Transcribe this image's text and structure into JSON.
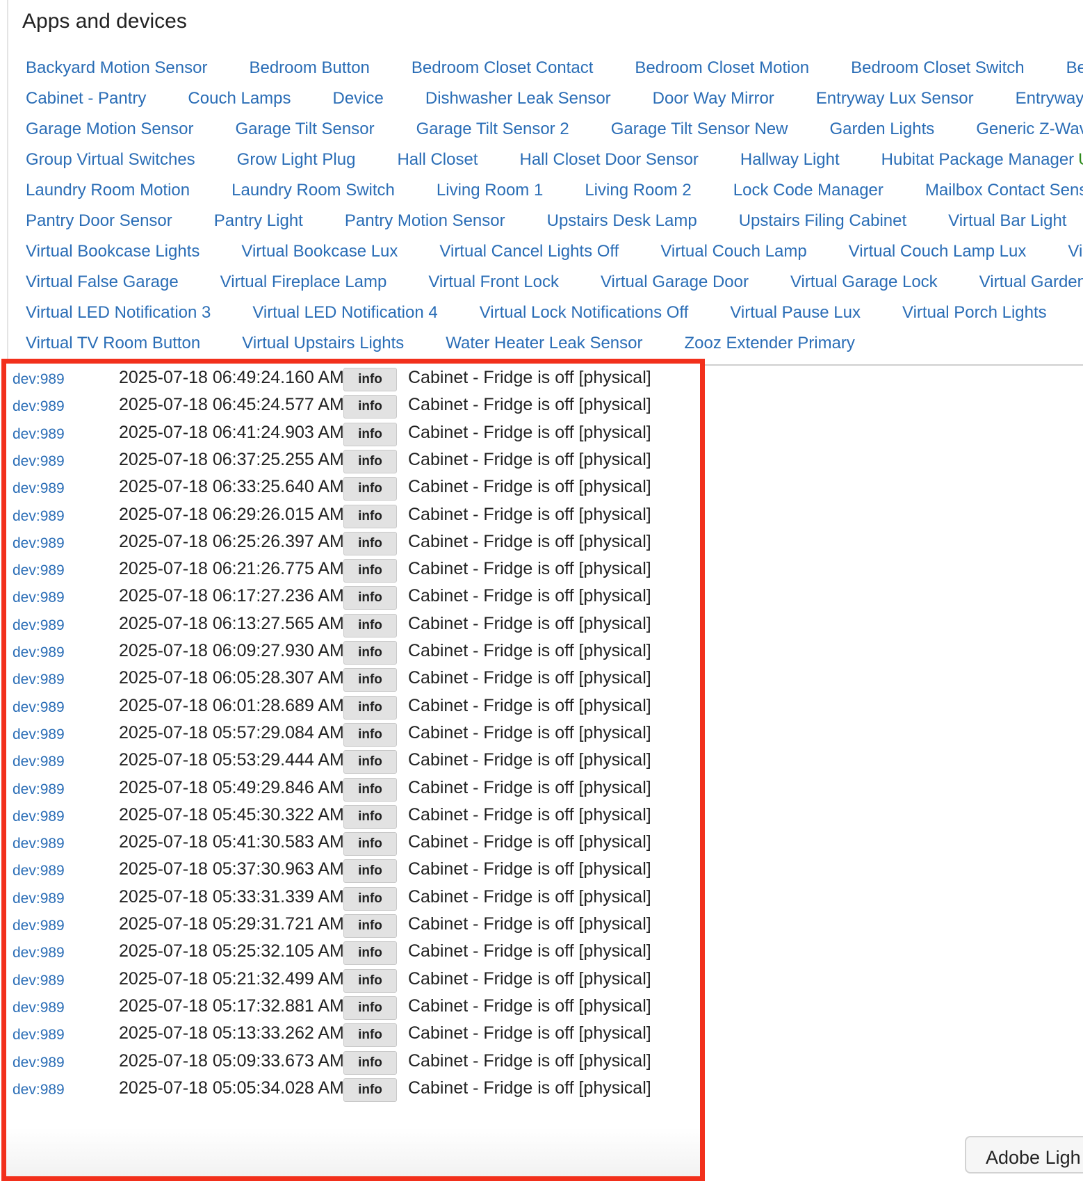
{
  "apps_panel": {
    "title": "Apps and devices",
    "rows": [
      [
        "Backyard Motion Sensor",
        "Bedroom Button",
        "Bedroom Closet Contact",
        "Bedroom Closet Motion",
        "Bedroom Closet Switch",
        "Bed"
      ],
      [
        "Cabinet - Pantry",
        "Couch Lamps",
        "Device",
        "Dishwasher Leak Sensor",
        "Door Way Mirror",
        "Entryway Lux Sensor",
        "Entryway Mo"
      ],
      [
        "Garage Motion Sensor",
        "Garage Tilt Sensor",
        "Garage Tilt Sensor 2",
        "Garage Tilt Sensor New",
        "Garden Lights",
        "Generic Z-Wave C"
      ],
      [
        "Group Virtual Switches",
        "Grow Light Plug",
        "Hall Closet",
        "Hall Closet Door Sensor",
        "Hallway Light",
        "Hubitat Package Manager"
      ],
      [
        "Laundry Room Motion",
        "Laundry Room Switch",
        "Living Room 1",
        "Living Room 2",
        "Lock Code Manager",
        "Mailbox Contact Sensor"
      ],
      [
        "Pantry Door Sensor",
        "Pantry Light",
        "Pantry Motion Sensor",
        "Upstairs Desk Lamp",
        "Upstairs Filing Cabinet",
        "Virtual Bar Light"
      ],
      [
        "Virtual Bookcase Lights",
        "Virtual Bookcase Lux",
        "Virtual Cancel Lights Off",
        "Virtual Couch Lamp",
        "Virtual Couch Lamp Lux",
        "Virt"
      ],
      [
        "Virtual False Garage",
        "Virtual Fireplace Lamp",
        "Virtual Front Lock",
        "Virtual Garage Door",
        "Virtual Garage Lock",
        "Virtual Garden Li"
      ],
      [
        "Virtual LED Notification 3",
        "Virtual LED Notification 4",
        "Virtual Lock Notifications Off",
        "Virtual Pause Lux",
        "Virtual Porch Lights"
      ],
      [
        "Virtual TV Room Button",
        "Virtual Upstairs Lights",
        "Water Heater Leak Sensor",
        "Zooz Extender Primary"
      ]
    ],
    "green_suffix": "Up",
    "link_color": "#2a6db6",
    "green_color": "#2e8b1c"
  },
  "log": {
    "highlight_color": "#f2301c",
    "entries": [
      {
        "dev": "dev:989",
        "time": "2025-07-18 06:49:24.160 AM",
        "level": "info",
        "msg": "Cabinet - Fridge is off [physical]"
      },
      {
        "dev": "dev:989",
        "time": "2025-07-18 06:45:24.577 AM",
        "level": "info",
        "msg": "Cabinet - Fridge is off [physical]"
      },
      {
        "dev": "dev:989",
        "time": "2025-07-18 06:41:24.903 AM",
        "level": "info",
        "msg": "Cabinet - Fridge is off [physical]"
      },
      {
        "dev": "dev:989",
        "time": "2025-07-18 06:37:25.255 AM",
        "level": "info",
        "msg": "Cabinet - Fridge is off [physical]"
      },
      {
        "dev": "dev:989",
        "time": "2025-07-18 06:33:25.640 AM",
        "level": "info",
        "msg": "Cabinet - Fridge is off [physical]"
      },
      {
        "dev": "dev:989",
        "time": "2025-07-18 06:29:26.015 AM",
        "level": "info",
        "msg": "Cabinet - Fridge is off [physical]"
      },
      {
        "dev": "dev:989",
        "time": "2025-07-18 06:25:26.397 AM",
        "level": "info",
        "msg": "Cabinet - Fridge is off [physical]"
      },
      {
        "dev": "dev:989",
        "time": "2025-07-18 06:21:26.775 AM",
        "level": "info",
        "msg": "Cabinet - Fridge is off [physical]"
      },
      {
        "dev": "dev:989",
        "time": "2025-07-18 06:17:27.236 AM",
        "level": "info",
        "msg": "Cabinet - Fridge is off [physical]"
      },
      {
        "dev": "dev:989",
        "time": "2025-07-18 06:13:27.565 AM",
        "level": "info",
        "msg": "Cabinet - Fridge is off [physical]"
      },
      {
        "dev": "dev:989",
        "time": "2025-07-18 06:09:27.930 AM",
        "level": "info",
        "msg": "Cabinet - Fridge is off [physical]"
      },
      {
        "dev": "dev:989",
        "time": "2025-07-18 06:05:28.307 AM",
        "level": "info",
        "msg": "Cabinet - Fridge is off [physical]"
      },
      {
        "dev": "dev:989",
        "time": "2025-07-18 06:01:28.689 AM",
        "level": "info",
        "msg": "Cabinet - Fridge is off [physical]"
      },
      {
        "dev": "dev:989",
        "time": "2025-07-18 05:57:29.084 AM",
        "level": "info",
        "msg": "Cabinet - Fridge is off [physical]"
      },
      {
        "dev": "dev:989",
        "time": "2025-07-18 05:53:29.444 AM",
        "level": "info",
        "msg": "Cabinet - Fridge is off [physical]"
      },
      {
        "dev": "dev:989",
        "time": "2025-07-18 05:49:29.846 AM",
        "level": "info",
        "msg": "Cabinet - Fridge is off [physical]"
      },
      {
        "dev": "dev:989",
        "time": "2025-07-18 05:45:30.322 AM",
        "level": "info",
        "msg": "Cabinet - Fridge is off [physical]"
      },
      {
        "dev": "dev:989",
        "time": "2025-07-18 05:41:30.583 AM",
        "level": "info",
        "msg": "Cabinet - Fridge is off [physical]"
      },
      {
        "dev": "dev:989",
        "time": "2025-07-18 05:37:30.963 AM",
        "level": "info",
        "msg": "Cabinet - Fridge is off [physical]"
      },
      {
        "dev": "dev:989",
        "time": "2025-07-18 05:33:31.339 AM",
        "level": "info",
        "msg": "Cabinet - Fridge is off [physical]"
      },
      {
        "dev": "dev:989",
        "time": "2025-07-18 05:29:31.721 AM",
        "level": "info",
        "msg": "Cabinet - Fridge is off [physical]"
      },
      {
        "dev": "dev:989",
        "time": "2025-07-18 05:25:32.105 AM",
        "level": "info",
        "msg": "Cabinet - Fridge is off [physical]"
      },
      {
        "dev": "dev:989",
        "time": "2025-07-18 05:21:32.499 AM",
        "level": "info",
        "msg": "Cabinet - Fridge is off [physical]"
      },
      {
        "dev": "dev:989",
        "time": "2025-07-18 05:17:32.881 AM",
        "level": "info",
        "msg": "Cabinet - Fridge is off [physical]"
      },
      {
        "dev": "dev:989",
        "time": "2025-07-18 05:13:33.262 AM",
        "level": "info",
        "msg": "Cabinet - Fridge is off [physical]"
      },
      {
        "dev": "dev:989",
        "time": "2025-07-18 05:09:33.673 AM",
        "level": "info",
        "msg": "Cabinet - Fridge is off [physical]"
      },
      {
        "dev": "dev:989",
        "time": "2025-07-18 05:05:34.028 AM",
        "level": "info",
        "msg": "Cabinet - Fridge is off [physical]"
      }
    ]
  },
  "tooltip": {
    "text": "Adobe Ligh"
  }
}
